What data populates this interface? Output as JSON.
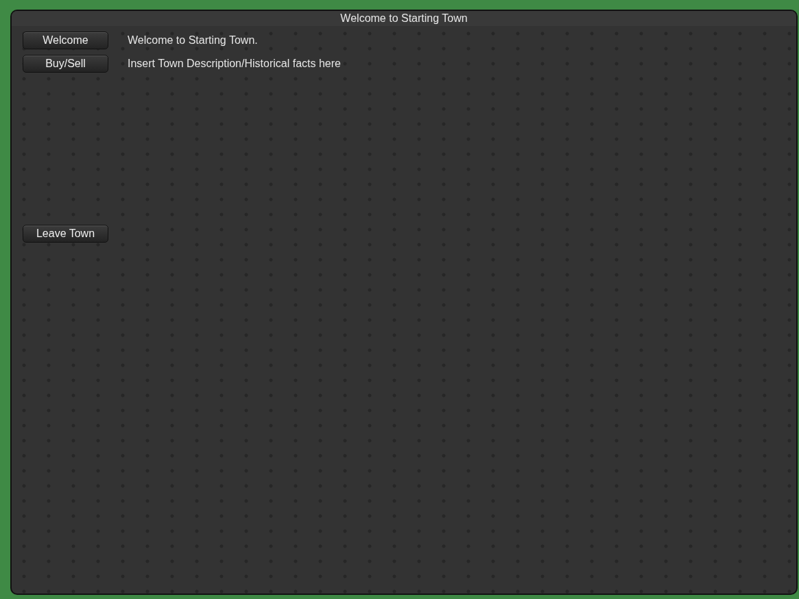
{
  "window": {
    "title": "Welcome to Starting Town"
  },
  "rows": [
    {
      "button": "Welcome",
      "text": "Welcome to Starting Town."
    },
    {
      "button": "Buy/Sell",
      "text": "Insert Town Description/Historical facts here"
    }
  ],
  "leave_button": "Leave Town"
}
